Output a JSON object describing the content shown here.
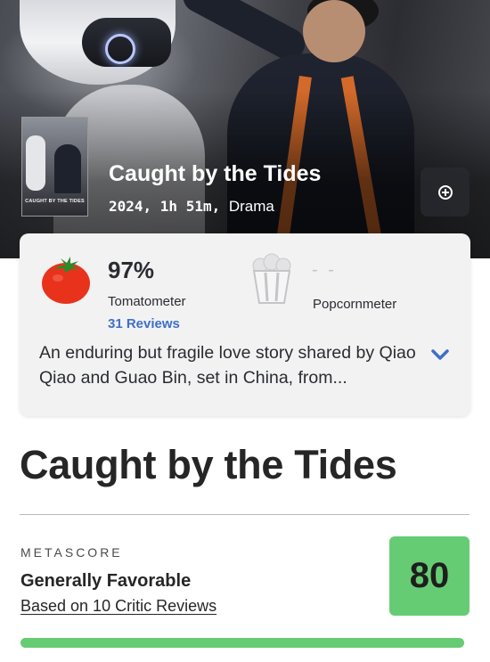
{
  "movie": {
    "title": "Caught by the Tides",
    "poster_text": "CAUGHT BY THE TIDES",
    "year": "2024",
    "runtime": "1h 51m",
    "genre": "Drama",
    "add_icon": "plus-circle-icon"
  },
  "tomatometer": {
    "score": "97%",
    "label": "Tomatometer",
    "reviews": "31 Reviews",
    "icon": "tomato-icon",
    "color": "#e8321c"
  },
  "popcornmeter": {
    "score": "- -",
    "label": "Popcornmeter",
    "icon": "popcorn-bucket-icon"
  },
  "synopsis": {
    "text": "An enduring but fragile love story shared by Qiao Qiao and Guao Bin, set in China, from...",
    "expand_icon": "chevron-down-icon",
    "accent": "#3d6fc6"
  },
  "metascore": {
    "label": "METASCORE",
    "verdict": "Generally Favorable",
    "reviews_link": "Based on 10 Critic Reviews",
    "score": "80",
    "score_value": 80,
    "color": "#66cc73"
  }
}
